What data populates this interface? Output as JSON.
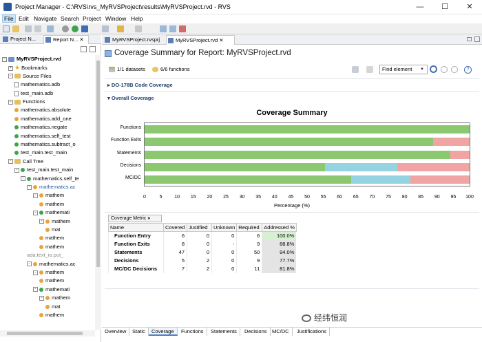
{
  "window": {
    "title": "Project Manager - C:\\RVS\\rvs_MyRVSProject\\results\\MyRVSProject.rvd - RVS"
  },
  "menu": [
    "File",
    "Edit",
    "Navigate",
    "Search",
    "Project",
    "Window",
    "Help"
  ],
  "left_tabs": [
    "Project N...",
    "Report N..."
  ],
  "tree": [
    {
      "label": "MyRVSProject.rvd",
      "level": 0,
      "exp": "-",
      "icon": "folder-blue",
      "bold": true
    },
    {
      "label": "Bookmarks",
      "level": 1,
      "exp": "+",
      "icon": "star"
    },
    {
      "label": "Source Files",
      "level": 1,
      "exp": "-",
      "icon": "folder"
    },
    {
      "label": "mathematics.adb",
      "level": 2,
      "icon": "file"
    },
    {
      "label": "test_main.adb",
      "level": 2,
      "icon": "file"
    },
    {
      "label": "Functions",
      "level": 1,
      "exp": "-",
      "icon": "folder"
    },
    {
      "label": "mathematics.absolute",
      "level": 2,
      "icon": "orange"
    },
    {
      "label": "mathematics.add_one",
      "level": 2,
      "icon": "orange"
    },
    {
      "label": "mathematics.negate",
      "level": 2,
      "icon": "green"
    },
    {
      "label": "mathematics.self_test",
      "level": 2,
      "icon": "green"
    },
    {
      "label": "mathematics.subtract_o",
      "level": 2,
      "icon": "green"
    },
    {
      "label": "test_main.test_main",
      "level": 2,
      "icon": "green"
    },
    {
      "label": "Call Tree",
      "level": 1,
      "exp": "-",
      "icon": "folder"
    },
    {
      "label": "test_main.test_main",
      "level": 2,
      "exp": "-",
      "icon": "green"
    },
    {
      "label": "mathematics.self_te",
      "level": 3,
      "exp": "-",
      "icon": "green"
    },
    {
      "label": "mathematics.ac",
      "level": 4,
      "exp": "-",
      "icon": "orange",
      "blue": true
    },
    {
      "label": "mathem",
      "level": 5,
      "exp": "-",
      "icon": "orange"
    },
    {
      "label": "mathem",
      "level": 6,
      "icon": "orange"
    },
    {
      "label": "mathemati",
      "level": 5,
      "exp": "-",
      "icon": "green"
    },
    {
      "label": "mathem",
      "level": 6,
      "exp": "-",
      "icon": "orange"
    },
    {
      "label": "mat",
      "level": 7,
      "icon": "orange"
    },
    {
      "label": "mathem",
      "level": 6,
      "icon": "orange"
    },
    {
      "label": "mathem",
      "level": 6,
      "icon": "orange"
    },
    {
      "label": "ada.text_io.put_",
      "level": 4,
      "icon": "none",
      "gray": true
    },
    {
      "label": "mathematics.ac",
      "level": 4,
      "exp": "-",
      "icon": "orange"
    },
    {
      "label": "mathem",
      "level": 5,
      "exp": "-",
      "icon": "orange"
    },
    {
      "label": "mathem",
      "level": 6,
      "icon": "orange"
    },
    {
      "label": "mathemati",
      "level": 5,
      "exp": "-",
      "icon": "green"
    },
    {
      "label": "mathem",
      "level": 6,
      "exp": "-",
      "icon": "orange"
    },
    {
      "label": "mat",
      "level": 7,
      "icon": "orange"
    },
    {
      "label": "mathem",
      "level": 6,
      "icon": "orange"
    }
  ],
  "editor_tabs": [
    "MyRVSProject.rvsprj",
    "MyRVSProject.rvd"
  ],
  "page_title": "Coverage Summary for Report: MyRVSProject.rvd",
  "summary": {
    "datasets": "1/1 datasets",
    "functions": "6/6 functions"
  },
  "find": {
    "value": "Find element"
  },
  "sections": {
    "do178b": "DO-178B Code Coverage",
    "overall": "Overall Coverage"
  },
  "chart_data": {
    "type": "bar",
    "orientation": "horizontal",
    "stacked": true,
    "title": "Coverage Summary",
    "xlabel": "Percentage (%)",
    "ylabel": "",
    "xlim": [
      0,
      100
    ],
    "xticks": [
      0,
      5,
      10,
      15,
      20,
      25,
      30,
      35,
      40,
      45,
      50,
      55,
      60,
      65,
      70,
      75,
      80,
      85,
      90,
      95,
      100
    ],
    "categories": [
      "Functions",
      "Function Exits",
      "Statements",
      "Decisions",
      "MC/DC"
    ],
    "series": [
      {
        "values": [
          100,
          88.8,
          94.0,
          55.5,
          63.6
        ],
        "color": "#8cc870"
      },
      {
        "values": [
          0,
          0,
          0,
          22.2,
          18.2
        ],
        "color": "#96d3e0"
      },
      {
        "values": [
          0,
          11.2,
          6.0,
          22.3,
          18.2
        ],
        "color": "#f0a4a4"
      }
    ]
  },
  "table": {
    "metric_button": "Coverage Metric",
    "columns": [
      "Name",
      "Covered",
      "Justified",
      "Unknown",
      "Required",
      "Addressed %"
    ],
    "rows": [
      [
        "Function Entry",
        "6",
        "0",
        "0",
        "6",
        "100.0%"
      ],
      [
        "Function Exits",
        "8",
        "0",
        "-",
        "9",
        "88.8%"
      ],
      [
        "Statements",
        "47",
        "0",
        "0",
        "50",
        "94.0%"
      ],
      [
        "Decisions",
        "5",
        "2",
        "0",
        "9",
        "77.7%"
      ],
      [
        "MC/DC Decisions",
        "7",
        "2",
        "0",
        "11",
        "81.8%"
      ]
    ]
  },
  "bottom_tabs": [
    "Overview",
    "Static",
    "Coverage",
    "Functions",
    "Statements",
    "Decisions",
    "MC/DC",
    "Justifications"
  ],
  "watermark": "经纬恒润",
  "colors": {
    "green": "#8cc870",
    "blue": "#96d3e0",
    "red": "#f0a4a4"
  }
}
